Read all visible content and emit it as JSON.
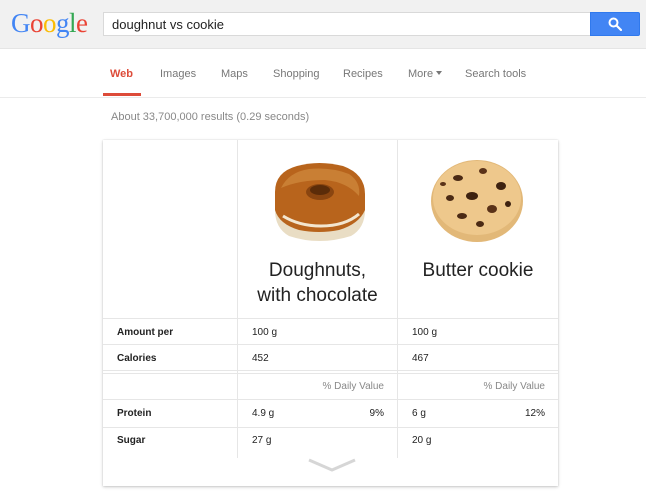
{
  "logo": {
    "letters": [
      "G",
      "o",
      "o",
      "g",
      "l",
      "e"
    ],
    "colors": [
      "#4285f4",
      "#ea4335",
      "#fbbc05",
      "#4285f4",
      "#34a853",
      "#ea4335"
    ]
  },
  "search": {
    "query": "doughnut vs cookie",
    "button_icon": "search-icon"
  },
  "tabs": [
    {
      "label": "Web",
      "active": true
    },
    {
      "label": "Images"
    },
    {
      "label": "Maps"
    },
    {
      "label": "Shopping"
    },
    {
      "label": "Recipes"
    },
    {
      "label": "More",
      "dropdown": true
    },
    {
      "label": "Search tools"
    }
  ],
  "results_stats": "About 33,700,000 results (0.29 seconds)",
  "comparison": {
    "foods": [
      {
        "name_line1": "Doughnuts,",
        "name_line2": "with chocolate",
        "image": "doughnut-image"
      },
      {
        "name_line1": "Butter cookie",
        "name_line2": "",
        "image": "cookie-image"
      }
    ],
    "rows": {
      "amount_label": "Amount per",
      "amount": [
        "100 g",
        "100 g"
      ],
      "calories_label": "Calories",
      "calories": [
        "452",
        "467"
      ],
      "daily_value_header": "% Daily Value",
      "protein_label": "Protein",
      "protein": [
        {
          "amount": "4.9 g",
          "dv": "9%"
        },
        {
          "amount": "6 g",
          "dv": "12%"
        }
      ],
      "sugar_label": "Sugar",
      "sugar": [
        "27 g",
        "20 g"
      ]
    },
    "expand_icon": "chevron-down-icon"
  },
  "colors": {
    "accent_red": "#dd4b39",
    "search_blue": "#4285f4"
  }
}
